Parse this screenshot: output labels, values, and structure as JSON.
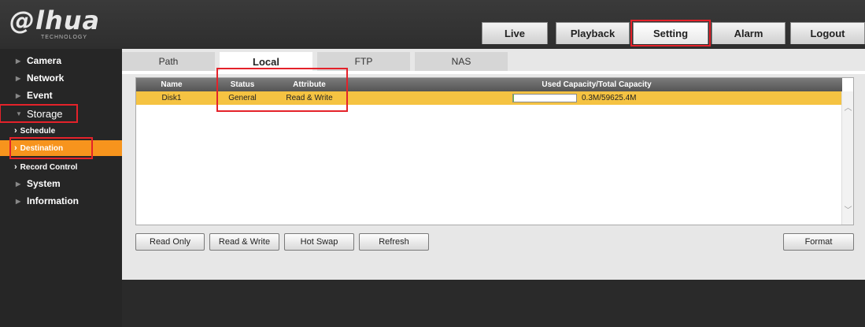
{
  "brand": {
    "name": "alhua",
    "sub": "TECHNOLOGY"
  },
  "top_nav": [
    {
      "label": "Live"
    },
    {
      "label": "Playback"
    },
    {
      "label": "Setting"
    },
    {
      "label": "Alarm"
    },
    {
      "label": "Logout"
    }
  ],
  "sidebar": {
    "items": [
      {
        "label": "Camera"
      },
      {
        "label": "Network"
      },
      {
        "label": "Event"
      },
      {
        "label": "Storage"
      },
      {
        "label": "System"
      },
      {
        "label": "Information"
      }
    ],
    "storage_sub": [
      {
        "label": "Schedule"
      },
      {
        "label": "Destination"
      },
      {
        "label": "Record Control"
      }
    ]
  },
  "sub_tabs": [
    {
      "label": "Path"
    },
    {
      "label": "Local"
    },
    {
      "label": "FTP"
    },
    {
      "label": "NAS"
    }
  ],
  "table": {
    "headers": [
      "Name",
      "Status",
      "Attribute",
      "Used Capacity/Total Capacity"
    ],
    "rows": [
      {
        "name": "Disk1",
        "status": "General",
        "attribute": "Read & Write",
        "capacity": "0.3M/59625.4M",
        "used_fraction": 0.005
      }
    ]
  },
  "buttons": {
    "read_only": "Read Only",
    "read_write": "Read & Write",
    "hot_swap": "Hot Swap",
    "refresh": "Refresh",
    "format": "Format"
  },
  "colors": {
    "accent": "#f7941d",
    "selected_row": "#f5c342",
    "highlight": "#e4222a"
  },
  "icons": {
    "collapsed": "triangle-right-icon",
    "expanded": "triangle-down-icon",
    "sub_item": "chevron-right-icon",
    "scroll_up": "chevron-up-icon",
    "scroll_down": "chevron-down-icon"
  }
}
